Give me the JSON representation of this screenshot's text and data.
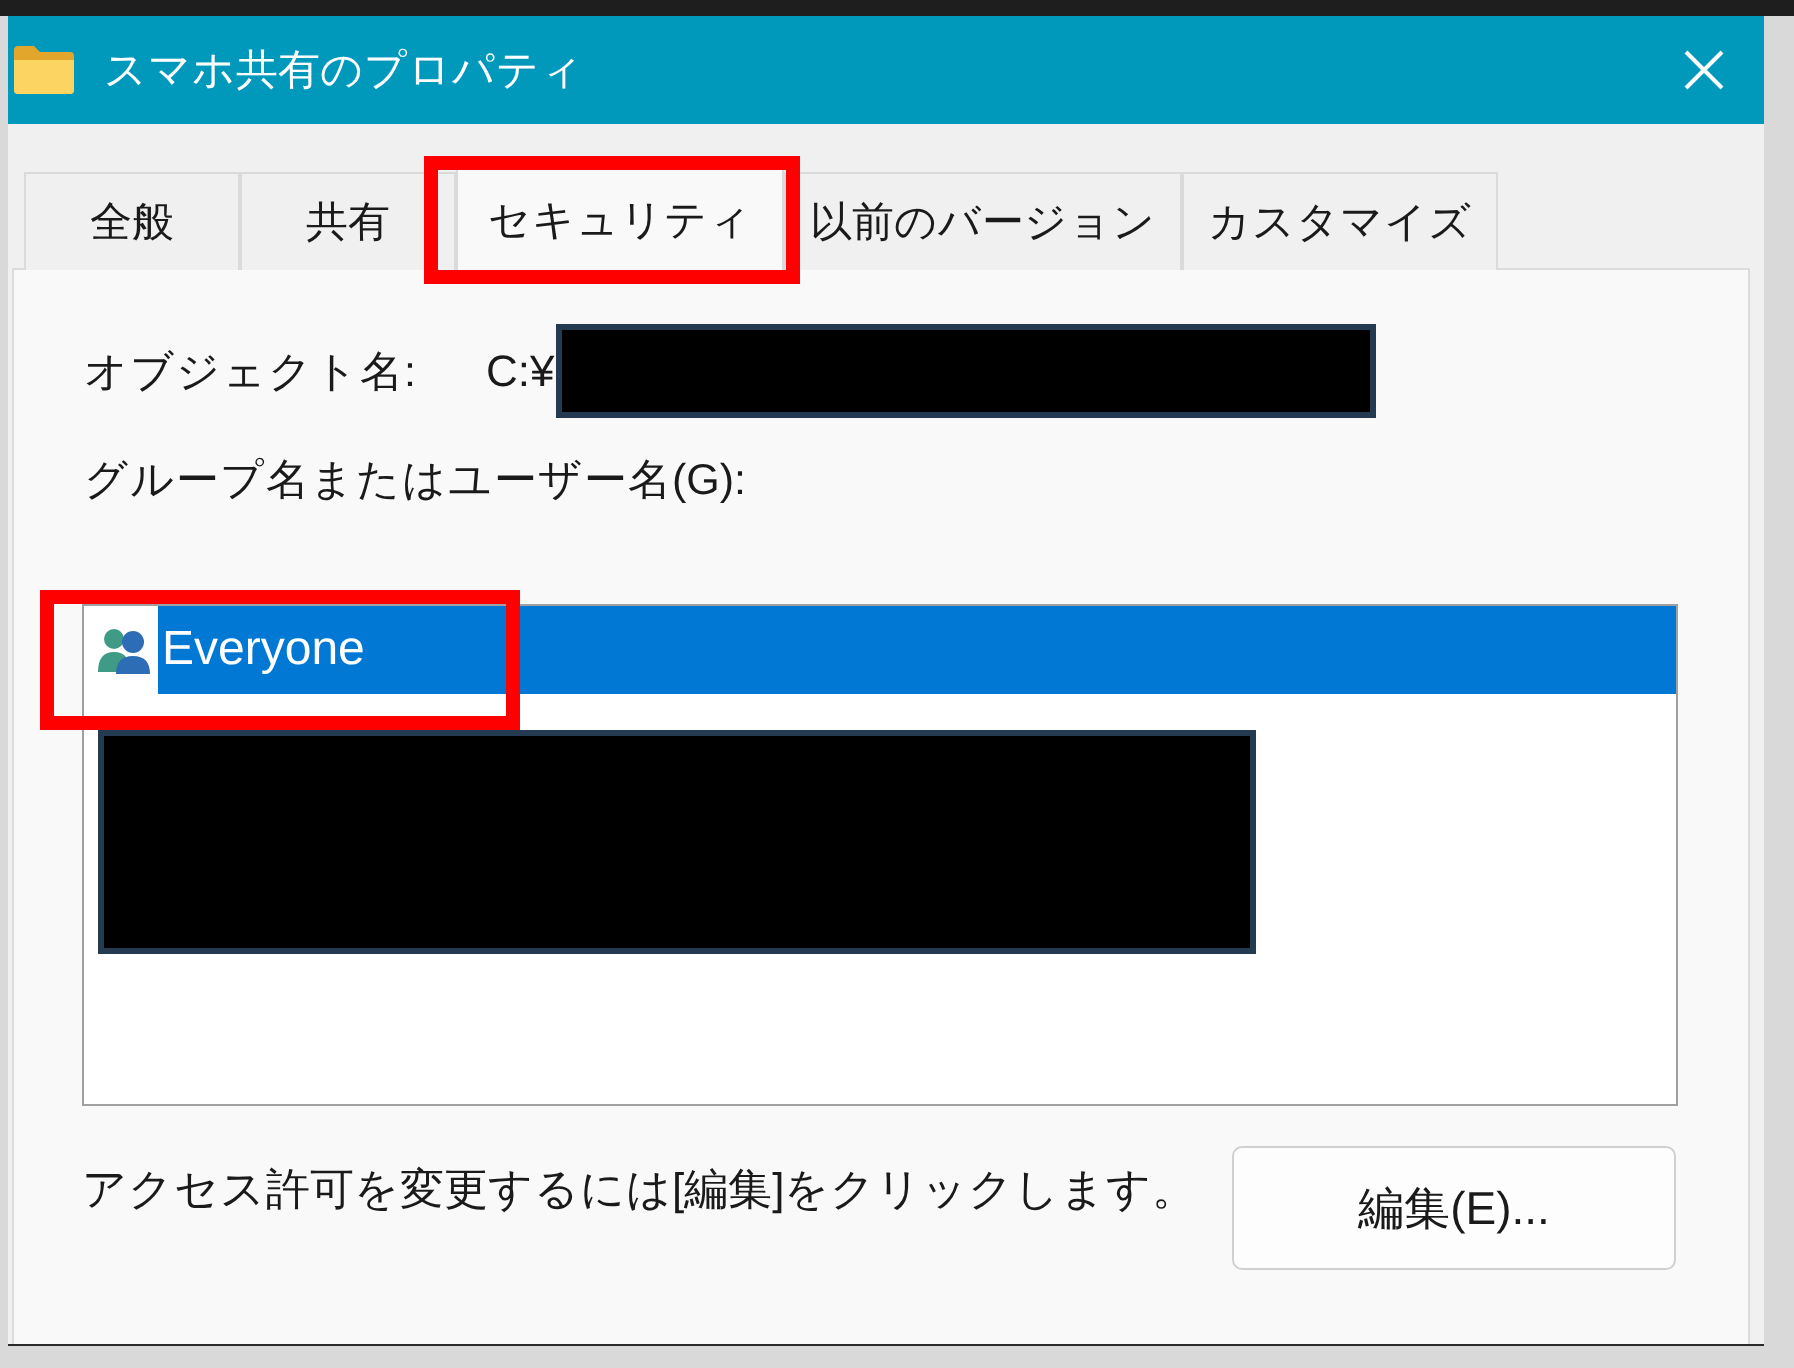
{
  "window": {
    "title": "スマホ共有のプロパティ"
  },
  "tabs": [
    {
      "label": "全般",
      "selected": false,
      "highlighted": false
    },
    {
      "label": "共有",
      "selected": false,
      "highlighted": false
    },
    {
      "label": "セキュリティ",
      "selected": true,
      "highlighted": true
    },
    {
      "label": "以前のバージョン",
      "selected": false,
      "highlighted": false
    },
    {
      "label": "カスタマイズ",
      "selected": false,
      "highlighted": false
    }
  ],
  "object_name": {
    "label": "オブジェクト名:",
    "value": "C:¥",
    "redacted": true
  },
  "users": {
    "label": "グループ名またはユーザー名(G):",
    "items": [
      {
        "kind": "group",
        "name": "Everyone",
        "selected": true,
        "highlighted": true
      },
      {
        "kind": "redacted",
        "selected": false,
        "highlighted": false
      }
    ]
  },
  "hint": "アクセス許可を変更するには[編集]をクリックします。",
  "buttons": [
    {
      "label": "編集(E)..."
    }
  ]
}
